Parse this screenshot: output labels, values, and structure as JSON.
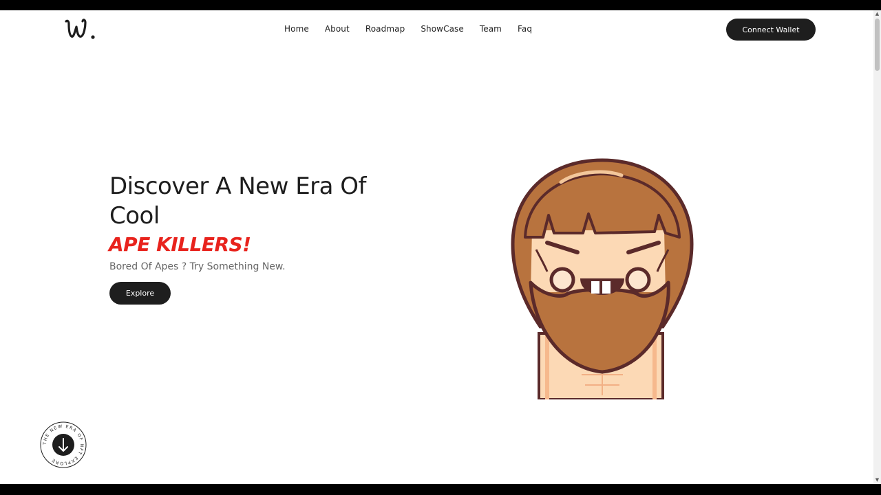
{
  "nav": {
    "logo_alt": "W.",
    "items": [
      "Home",
      "About",
      "Roadmap",
      "ShowCase",
      "Team",
      "Faq"
    ],
    "wallet_label": "Connect Wallet"
  },
  "hero": {
    "title": "Discover A New Era Of Cool",
    "accent": "APE KILLERS!",
    "subtitle": "Bored Of Apes ? Try Something New.",
    "explore_label": "Explore"
  },
  "badge": {
    "ring_text": "THE NEW ERA OF NFT EXPLORE",
    "icon": "arrow-down-icon"
  },
  "colors": {
    "accent": "#e8231d",
    "dark": "#1e1e1e",
    "hair": "#b8733e",
    "skin": "#fcd9b5"
  }
}
